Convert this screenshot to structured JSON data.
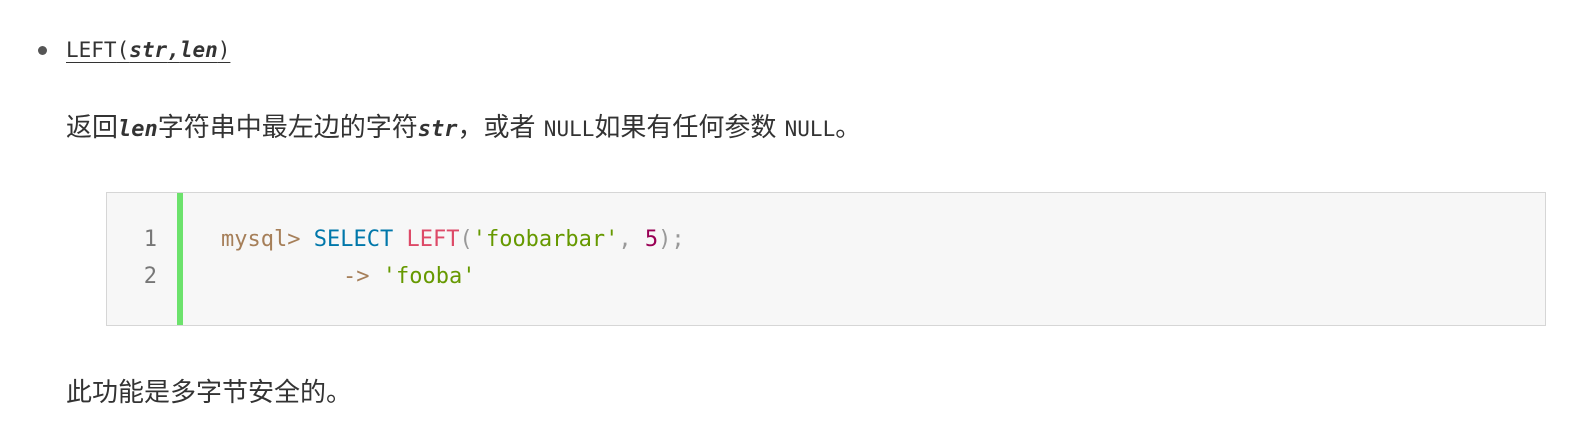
{
  "signature": {
    "func_name": "LEFT",
    "open_paren": "(",
    "param1": "str",
    "comma": ",",
    "param2": "len",
    "close_paren": ")"
  },
  "description": {
    "part1": "返回",
    "param_len": "len",
    "part2": "字符串中最左边的字符",
    "param_str": "str",
    "part3": "，或者 ",
    "null1": "NULL",
    "part4": "如果有任何参数 ",
    "null2": "NULL",
    "part5": "。"
  },
  "code_example": {
    "line_numbers": [
      "1",
      "2"
    ],
    "line1": {
      "prompt": "mysql>",
      "keyword": "SELECT",
      "func": "LEFT",
      "open_paren": "(",
      "string": "'foobarbar'",
      "comma": ",",
      "number": "5",
      "close": ");"
    },
    "line2": {
      "arrow": "->",
      "result": "'fooba'"
    },
    "accent_color": "#6ce26c"
  },
  "note": "此功能是多字节安全的。"
}
